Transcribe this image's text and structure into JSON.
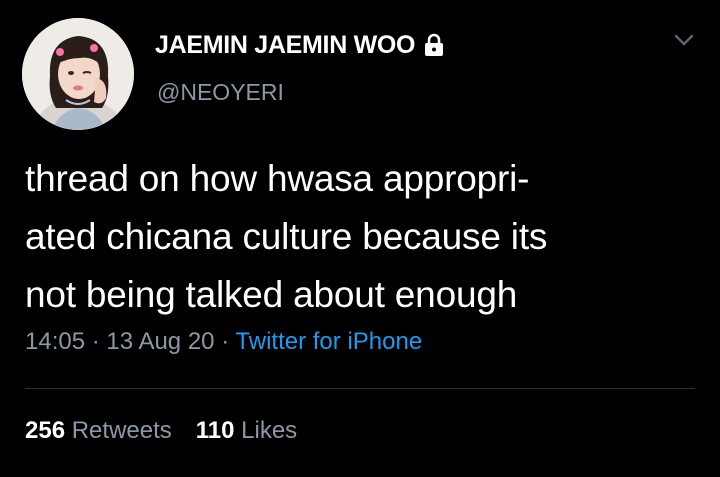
{
  "user": {
    "display_name": "JAEMIN JAEMIN WOO",
    "handle": "@NEOYERI",
    "protected_icon": "lock-icon",
    "avatar_icon": "avatar-photo"
  },
  "tweet": {
    "lines": [
      "thread on how hwasa appropri-",
      "ated chicana culture because its",
      "not being talked about enough"
    ],
    "time": "14:05",
    "date": "13 Aug 20",
    "separator": "·",
    "source": "Twitter for iPhone"
  },
  "stats": {
    "retweets_count": "256",
    "retweets_label": "Retweets",
    "likes_count": "110",
    "likes_label": "Likes"
  },
  "colors": {
    "background": "#000000",
    "text": "#ffffff",
    "secondary": "#8b98a5",
    "link": "#1d9bf0"
  },
  "menu_icon": "chevron-down-icon"
}
